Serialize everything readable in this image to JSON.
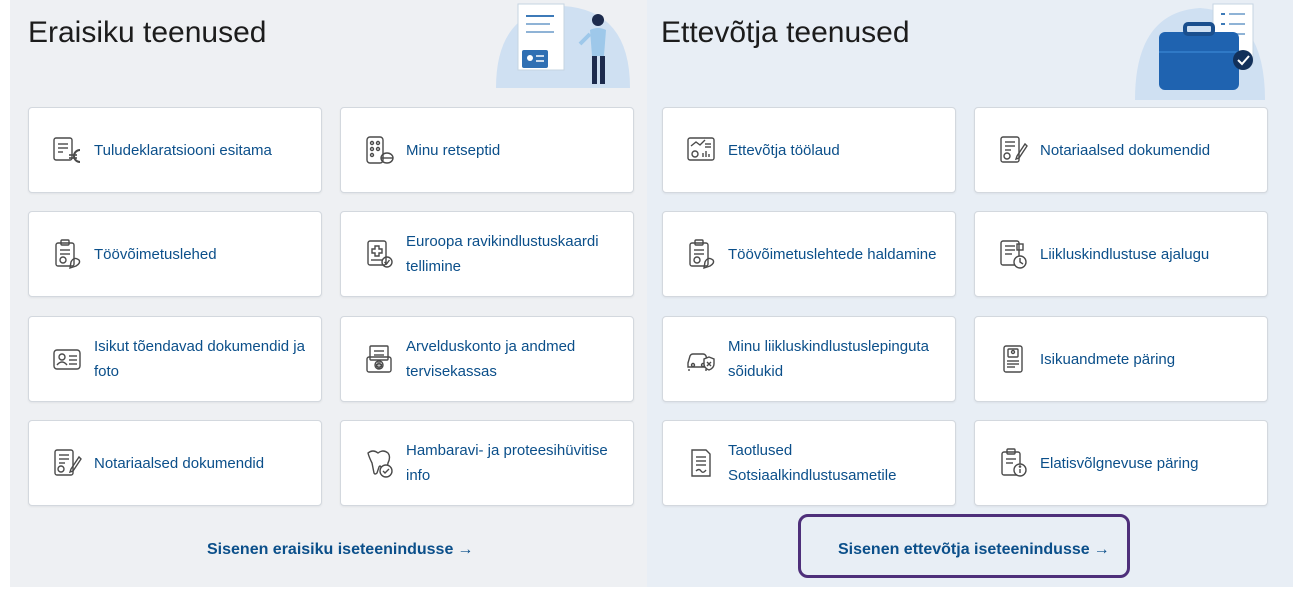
{
  "personal": {
    "title": "Eraisiku teenused",
    "cards": [
      {
        "label": "Tuludeklaratsiooni esitama",
        "icon": "tax-declaration-euro-icon"
      },
      {
        "label": "Minu retseptid",
        "icon": "prescription-pills-icon"
      },
      {
        "label": "Töövõimetuslehed",
        "icon": "sick-leave-clipboard-icon"
      },
      {
        "label": "Euroopa ravikindlustuskaardi tellimine",
        "icon": "health-insurance-card-icon"
      },
      {
        "label": "Isikut tõendavad dokumendid ja foto",
        "icon": "id-card-icon"
      },
      {
        "label": "Arvelduskonto ja andmed tervisekassas",
        "icon": "bank-account-icon"
      },
      {
        "label": "Notariaalsed dokumendid",
        "icon": "notary-document-icon"
      },
      {
        "label": "Hambaravi- ja proteesihüvitise info",
        "icon": "tooth-icon"
      }
    ],
    "enter_label": "Sisenen eraisiku iseteenindusse",
    "arrow": "→"
  },
  "business": {
    "title": "Ettevõtja teenused",
    "cards": [
      {
        "label": "Ettevõtja töölaud",
        "icon": "business-dashboard-icon"
      },
      {
        "label": "Notariaalsed dokumendid",
        "icon": "notary-document-icon"
      },
      {
        "label": "Töövõimetuslehtede haldamine",
        "icon": "sick-leave-clipboard-icon"
      },
      {
        "label": "Liikluskindlustuse ajalugu",
        "icon": "traffic-insurance-history-icon"
      },
      {
        "label": "Minu liikluskindlustuslepinguta sõidukid",
        "icon": "uninsured-vehicle-icon"
      },
      {
        "label": "Isikuandmete päring",
        "icon": "personal-data-query-icon"
      },
      {
        "label": "Taotlused Sotsiaalkindlustusametile",
        "icon": "application-document-icon"
      },
      {
        "label": "Elatisvõlgnevuse päring",
        "icon": "maintenance-debt-info-icon"
      }
    ],
    "enter_label": "Sisenen ettevõtja iseteenindusse",
    "arrow": "→"
  },
  "colors": {
    "link": "#0b4f8a",
    "icon_stroke": "#4a4a4a",
    "highlight": "#4e2f7a",
    "left_bg": "#eef0f3",
    "right_bg": "#e8eef5"
  }
}
